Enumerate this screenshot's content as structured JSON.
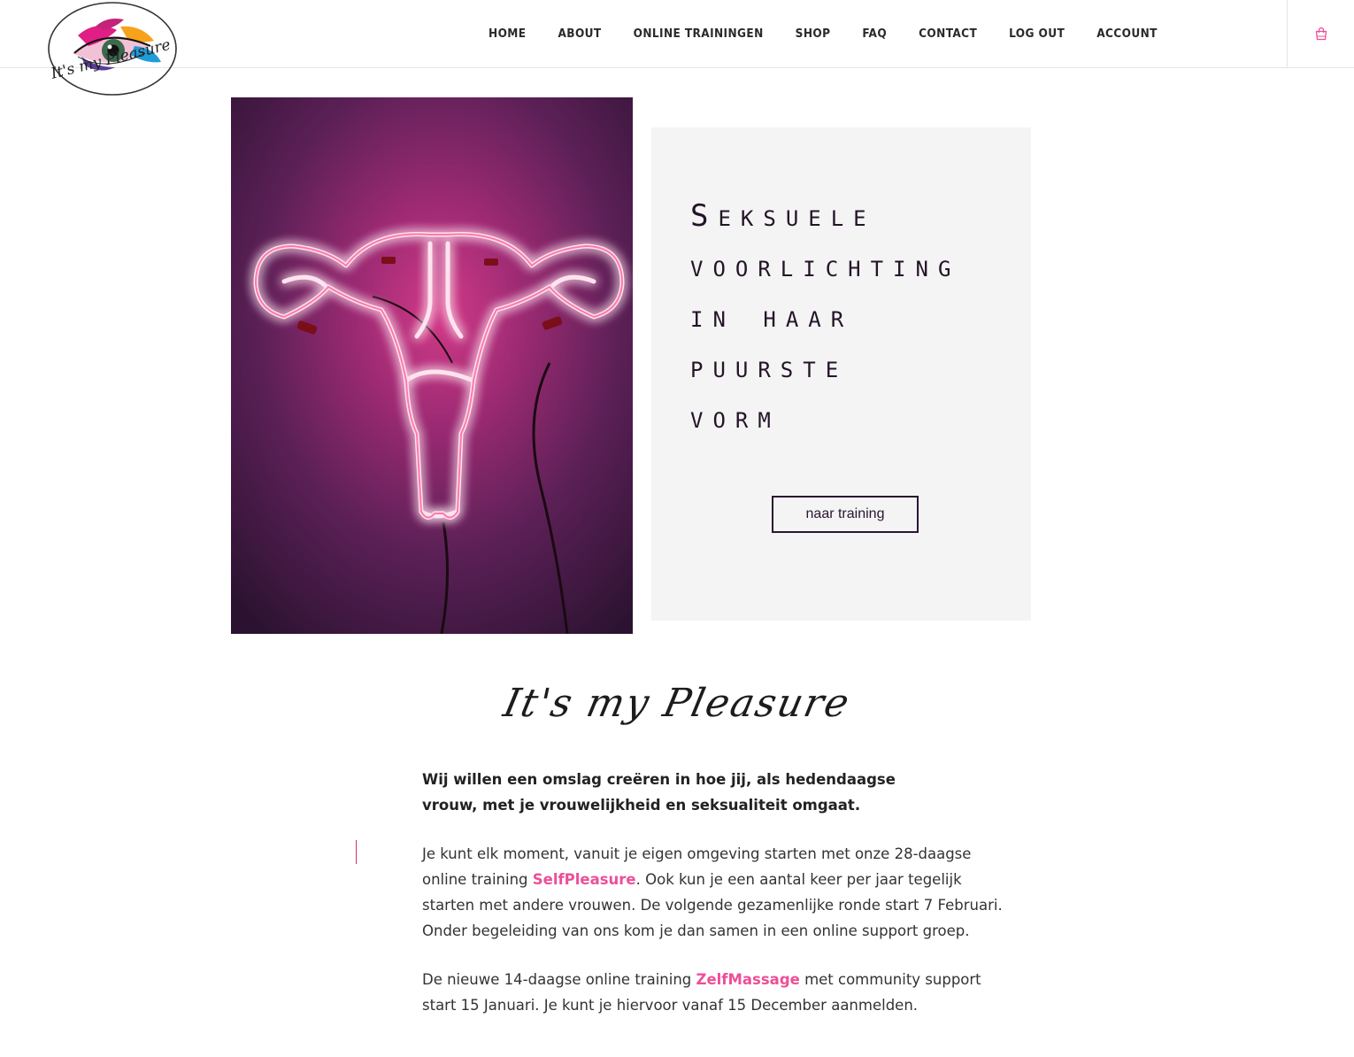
{
  "header": {
    "logo_text": "It's my Pleasure",
    "nav": [
      {
        "label": "HOME"
      },
      {
        "label": "ABOUT"
      },
      {
        "label": "ONLINE TRAININGEN"
      },
      {
        "label": "SHOP"
      },
      {
        "label": "FAQ"
      },
      {
        "label": "CONTACT"
      },
      {
        "label": "LOG OUT"
      },
      {
        "label": "ACCOUNT"
      }
    ],
    "cart_icon": "shopping-bag-icon"
  },
  "hero": {
    "image_icon": "neon-uterus-image",
    "title_lines": [
      "Seksuele",
      "voorlichting",
      "in haar",
      "puurste",
      "vorm"
    ],
    "button_label": "naar training"
  },
  "script_title": "It's my Pleasure",
  "content": {
    "lead": "Wij willen een omslag creëren in hoe jij, als hedendaagse vrouw, met je vrouwelijkheid en seksualiteit omgaat.",
    "p1_before": "Je kunt elk moment, vanuit je eigen omgeving starten met onze 28-daagse online training ",
    "p1_link": "SelfPleasure",
    "p1_after": ". Ook kun je een aantal keer per jaar tegelijk starten met andere vrouwen. De volgende gezamenlijke ronde start 7 Februari. Onder begeleiding van ons kom je dan samen in een online support groep.",
    "p2_before": "De nieuwe 14-daagse online training ",
    "p2_link": "ZelfMassage",
    "p2_after": " met community support start 15 Januari. Je kunt je hiervoor vanaf 15 December aanmelden."
  },
  "colors": {
    "accent_pink": "#ec4f98",
    "dark_purple": "#2b1533",
    "panel_bg": "#f4f4f4"
  }
}
